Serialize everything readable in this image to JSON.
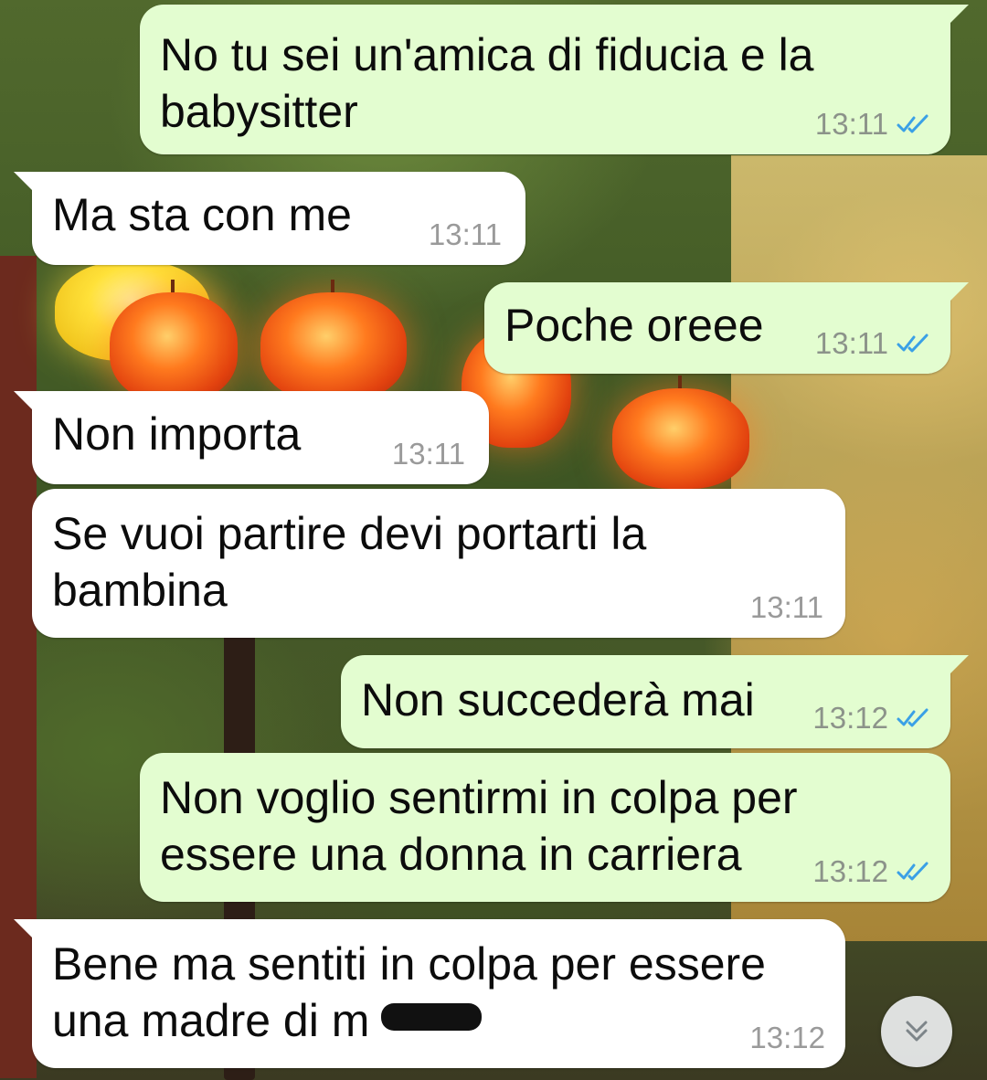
{
  "chat": {
    "background": "wallpaper-lanterns",
    "messages": [
      {
        "direction": "out",
        "text_lines": [
          "No tu sei un'amica di fiducia e la",
          "babysitter"
        ],
        "time": "13:11",
        "status": "read"
      },
      {
        "direction": "in",
        "text_lines": [
          "Ma sta con me"
        ],
        "time": "13:11"
      },
      {
        "direction": "out",
        "text_lines": [
          "Poche oreee"
        ],
        "time": "13:11",
        "status": "read"
      },
      {
        "direction": "in",
        "text_lines": [
          "Non importa"
        ],
        "time": "13:11"
      },
      {
        "direction": "in",
        "text_lines": [
          "Se vuoi partire devi portarti la",
          "bambina"
        ],
        "time": "13:11"
      },
      {
        "direction": "out",
        "text_lines": [
          "Non succederà mai"
        ],
        "time": "13:12",
        "status": "read"
      },
      {
        "direction": "out",
        "text_lines": [
          "Non voglio sentirmi in colpa per",
          "essere una donna in carriera"
        ],
        "time": "13:12",
        "status": "read"
      },
      {
        "direction": "in",
        "text_lines": [
          "Bene ma sentiti in colpa per essere",
          "una madre di m"
        ],
        "time": "13:12",
        "redacted_tail": true
      }
    ],
    "read_tick_color": "#3aa0e6",
    "scroll_button": {
      "icon": "double-chevron-down-icon"
    }
  }
}
